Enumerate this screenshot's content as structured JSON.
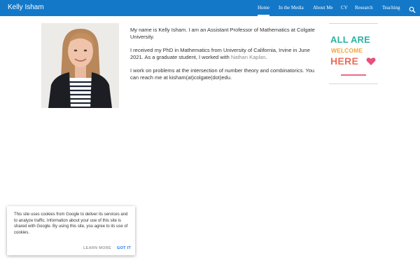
{
  "header": {
    "site_title": "Kelly Isham",
    "nav": [
      "Home",
      "In the Media",
      "About Me",
      "CV",
      "Research",
      "Teaching"
    ],
    "active": "Home",
    "bar_color": "#1478c8",
    "search_icon": "search-icon"
  },
  "main": {
    "bio": {
      "p1": "My name is Kelly Isham. I am an Assistant Professor of Mathematics at Colgate University.",
      "p2_before": "I received my PhD in Mathematics from University of California, Irvine in June 2021. As a graduate student, I worked with ",
      "p2_link": "Nathan Kaplan",
      "p2_after": ".",
      "p3": "I work on problems at the intersection of number theory and combinatorics. You can reach me at kisham(at)colgate(dot)edu."
    }
  },
  "sidebar": {
    "welcome_lines": [
      "ALL ARE",
      "WELCOME",
      "HERE"
    ],
    "heart_icon": "heart-icon"
  },
  "cookie": {
    "text": "This site uses cookies from Google to deliver its services and to analyze traffic. Information about your use of this site is shared with Google. By using this site, you agree to its use of cookies.",
    "learn_more": "LEARN MORE",
    "got_it": "GOT IT"
  }
}
